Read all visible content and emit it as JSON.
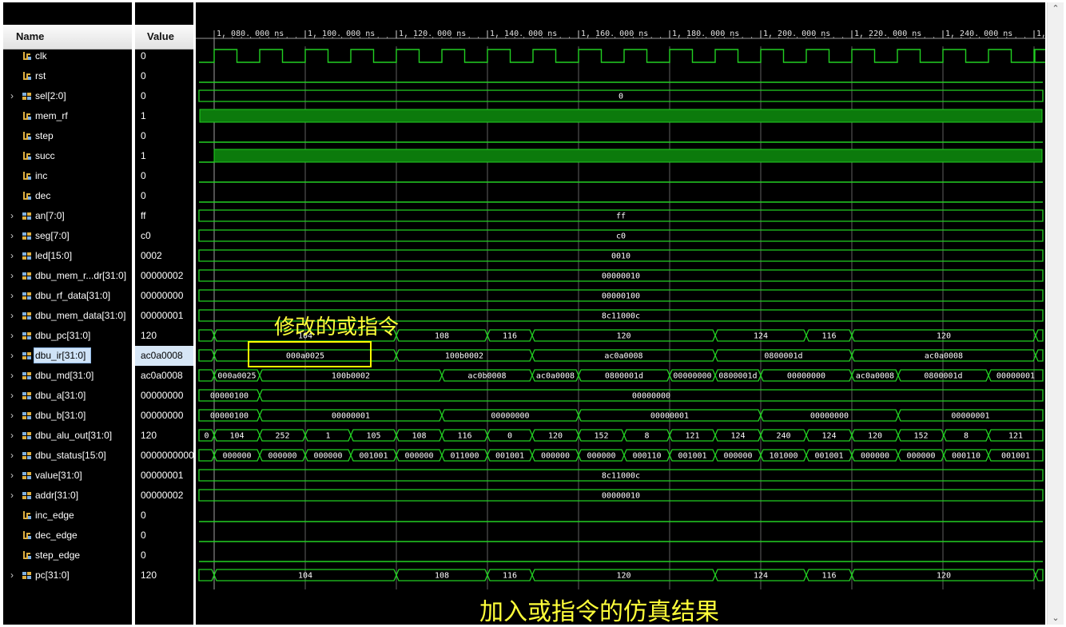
{
  "header": {
    "name_col": "Name",
    "value_col": "Value"
  },
  "timeline": {
    "labels": [
      "1, 080. 000 ns",
      "1, 100. 000 ns",
      "1, 120. 000 ns",
      "1, 140. 000 ns",
      "1, 160. 000 ns",
      "1, 180. 000 ns",
      "1, 200. 000 ns",
      "1, 220. 000 ns",
      "1, 240. 000 ns",
      "1,"
    ]
  },
  "signals": [
    {
      "name": "clk",
      "value": "0",
      "kind": "bit",
      "expandable": false
    },
    {
      "name": "rst",
      "value": "0",
      "kind": "bit",
      "expandable": false
    },
    {
      "name": "sel[2:0]",
      "value": "0",
      "kind": "bus",
      "expandable": true
    },
    {
      "name": "mem_rf",
      "value": "1",
      "kind": "bit",
      "expandable": false
    },
    {
      "name": "step",
      "value": "0",
      "kind": "bit",
      "expandable": false
    },
    {
      "name": "succ",
      "value": "1",
      "kind": "bit",
      "expandable": false
    },
    {
      "name": "inc",
      "value": "0",
      "kind": "bit",
      "expandable": false
    },
    {
      "name": "dec",
      "value": "0",
      "kind": "bit",
      "expandable": false
    },
    {
      "name": "an[7:0]",
      "value": "ff",
      "kind": "bus",
      "expandable": true
    },
    {
      "name": "seg[7:0]",
      "value": "c0",
      "kind": "bus",
      "expandable": true
    },
    {
      "name": "led[15:0]",
      "value": "0002",
      "kind": "bus",
      "expandable": true
    },
    {
      "name": "dbu_mem_r...dr[31:0]",
      "value": "00000002",
      "kind": "bus",
      "expandable": true
    },
    {
      "name": "dbu_rf_data[31:0]",
      "value": "00000000",
      "kind": "bus",
      "expandable": true
    },
    {
      "name": "dbu_mem_data[31:0]",
      "value": "00000001",
      "kind": "bus",
      "expandable": true
    },
    {
      "name": "dbu_pc[31:0]",
      "value": "120",
      "kind": "bus",
      "expandable": true
    },
    {
      "name": "dbu_ir[31:0]",
      "value": "ac0a0008",
      "kind": "bus",
      "expandable": true,
      "selected": true
    },
    {
      "name": "dbu_md[31:0]",
      "value": "ac0a0008",
      "kind": "bus",
      "expandable": true
    },
    {
      "name": "dbu_a[31:0]",
      "value": "00000000",
      "kind": "bus",
      "expandable": true
    },
    {
      "name": "dbu_b[31:0]",
      "value": "00000000",
      "kind": "bus",
      "expandable": true
    },
    {
      "name": "dbu_alu_out[31:0]",
      "value": "120",
      "kind": "bus",
      "expandable": true
    },
    {
      "name": "dbu_status[15:0]",
      "value": "0000000000",
      "kind": "bus",
      "expandable": true
    },
    {
      "name": "value[31:0]",
      "value": "00000001",
      "kind": "bus",
      "expandable": true
    },
    {
      "name": "addr[31:0]",
      "value": "00000002",
      "kind": "bus",
      "expandable": true
    },
    {
      "name": "inc_edge",
      "value": "0",
      "kind": "bit",
      "expandable": false
    },
    {
      "name": "dec_edge",
      "value": "0",
      "kind": "bit",
      "expandable": false
    },
    {
      "name": "step_edge",
      "value": "0",
      "kind": "bit",
      "expandable": false
    },
    {
      "name": "pc[31:0]",
      "value": "120",
      "kind": "bus",
      "expandable": true
    }
  ],
  "waves": {
    "sel": [
      "0"
    ],
    "an": [
      "ff"
    ],
    "seg": [
      "c0"
    ],
    "led": [
      "0010"
    ],
    "dbu_mem_raddr": [
      "00000010"
    ],
    "dbu_rf_data": [
      "00000100"
    ],
    "dbu_mem_data": [
      "8c11000c"
    ],
    "dbu_pc": [
      "104",
      "108",
      "116",
      "120",
      "124",
      "116",
      "120"
    ],
    "dbu_ir": [
      "000a0025",
      "100b0002",
      "ac0a0008",
      "0800001d",
      "ac0a0008"
    ],
    "dbu_md": [
      "000a0025",
      "100b0002",
      "ac0b0008",
      "ac0a0008",
      "0800001d",
      "00000000",
      "0800001d",
      "00000000",
      "ac0a0008",
      "0800001d",
      "00000001"
    ],
    "dbu_a": [
      "00000100",
      "00000000"
    ],
    "dbu_b": [
      "00000100",
      "00000001",
      "00000000",
      "00000001",
      "00000000",
      "00000001"
    ],
    "dbu_alu_out": [
      "0",
      "104",
      "252",
      "1",
      "105",
      "108",
      "116",
      "0",
      "120",
      "152",
      "8",
      "121",
      "124",
      "240",
      "124",
      "120",
      "152",
      "8",
      "121"
    ],
    "dbu_status": [
      "000000",
      "000000",
      "000000",
      "001001",
      "000000",
      "011000",
      "001001",
      "000000",
      "000000",
      "000110",
      "001001",
      "000000",
      "101000",
      "001001",
      "000000",
      "000000",
      "000110",
      "001001"
    ],
    "value": [
      "8c11000c"
    ],
    "addr": [
      "00000010"
    ],
    "pc": [
      "104",
      "108",
      "116",
      "120",
      "124",
      "116",
      "120"
    ]
  },
  "annotations": {
    "modified_label": "修改的或指令",
    "bottom_caption": "加入或指令的仿真结果"
  },
  "colors": {
    "wave": "#22d022",
    "fill": "#0c7a0c",
    "text": "#ffffff",
    "annotation": "#ffff3a",
    "background": "#000000"
  }
}
